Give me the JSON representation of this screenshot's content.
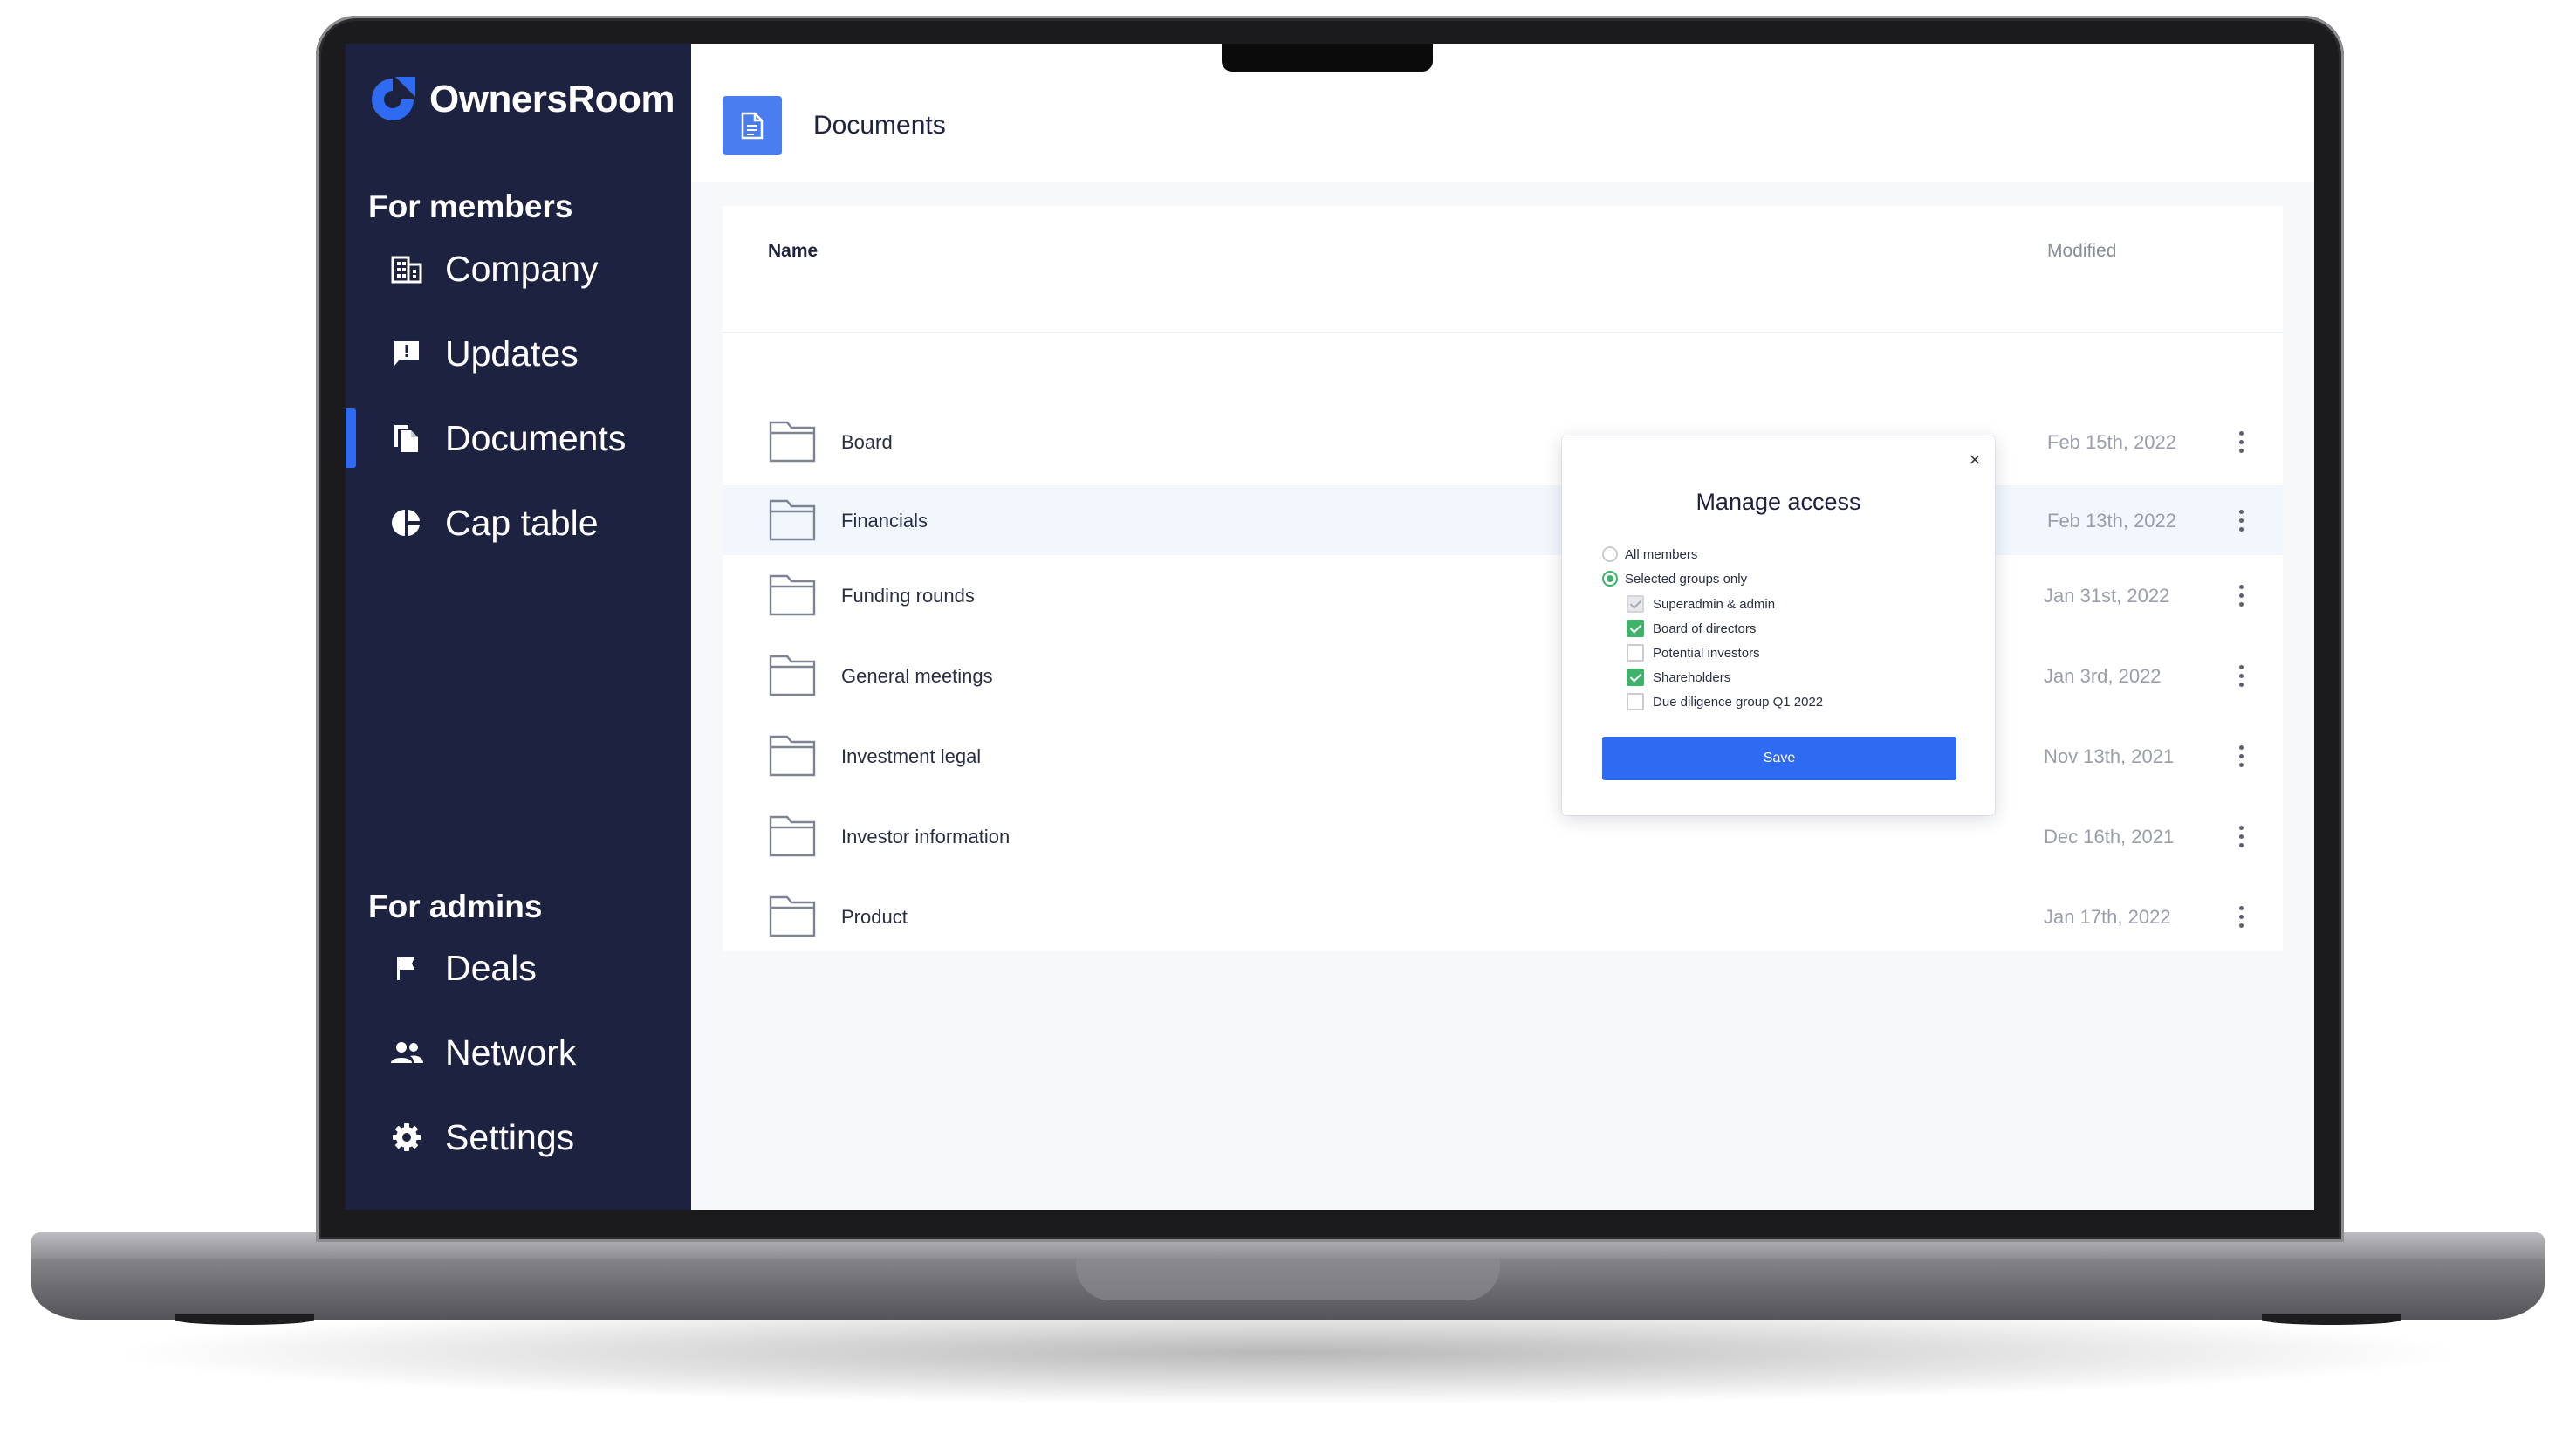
{
  "app": {
    "brand": "OwnersRoom",
    "brand_color": "#2f6bf2",
    "sidebar_color": "#1e2241"
  },
  "sidebar": {
    "members_title": "For members",
    "members_items": [
      {
        "label": "Company",
        "icon": "building-icon"
      },
      {
        "label": "Updates",
        "icon": "feedback-icon"
      },
      {
        "label": "Documents",
        "icon": "documents-icon",
        "active": true
      },
      {
        "label": "Cap table",
        "icon": "pie-chart-icon"
      }
    ],
    "admins_title": "For admins",
    "admins_items": [
      {
        "label": "Deals",
        "icon": "flag-icon"
      },
      {
        "label": "Network",
        "icon": "people-icon"
      },
      {
        "label": "Settings",
        "icon": "gear-icon"
      }
    ]
  },
  "header": {
    "title": "Documents",
    "icon": "document-icon"
  },
  "table": {
    "col_name": "Name",
    "col_modified": "Modified",
    "rows": [
      {
        "name": "Board",
        "modified": "Feb 15th, 2022"
      },
      {
        "name": "Financials",
        "modified": "Feb 13th, 2022",
        "highlighted": true
      },
      {
        "name": "Funding rounds",
        "modified": "Jan 31st, 2022"
      },
      {
        "name": "General meetings",
        "modified": "Jan 3rd, 2022"
      },
      {
        "name": "Investment legal",
        "modified": "Nov 13th, 2021"
      },
      {
        "name": "Investor information",
        "modified": "Dec 16th, 2021"
      },
      {
        "name": "Product",
        "modified": "Jan 17th, 2022"
      }
    ]
  },
  "modal": {
    "title": "Manage access",
    "close": "×",
    "radio_all": "All members",
    "radio_selected": "Selected groups only",
    "radio_value": "Selected groups only",
    "groups": [
      {
        "label": "Superadmin & admin",
        "checked": true,
        "disabled": true
      },
      {
        "label": "Board of directors",
        "checked": true
      },
      {
        "label": "Potential investors",
        "checked": false
      },
      {
        "label": "Shareholders",
        "checked": true
      },
      {
        "label": "Due diligence group Q1 2022",
        "checked": false
      }
    ],
    "save_label": "Save",
    "check_color": "#3fb36b"
  }
}
